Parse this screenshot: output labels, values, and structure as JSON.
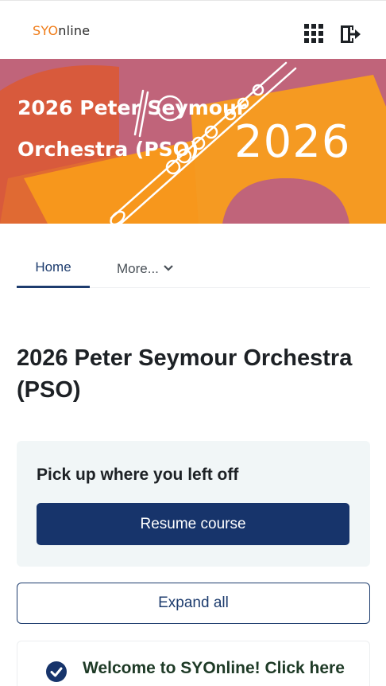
{
  "header": {
    "logo_part1": "SYO",
    "logo_part2": "nline",
    "apps_icon": "grid-apps-icon",
    "logout_icon": "logout-icon"
  },
  "banner": {
    "title": "2026 Peter Seymour Orchestra (PSO)",
    "year": "2026",
    "colors": {
      "pink": "#c0647a",
      "orange": "#f7971c",
      "red": "#d85a3c"
    }
  },
  "nav": {
    "tabs": [
      {
        "label": "Home",
        "active": true
      },
      {
        "label": "More...",
        "active": false
      }
    ]
  },
  "main": {
    "title": "2026 Peter Seymour Orchestra (PSO)",
    "resume": {
      "heading": "Pick up where you left off",
      "button": "Resume course"
    },
    "expand_all": "Expand all",
    "section": {
      "title": "Welcome to SYOnline! Click here",
      "status_icon": "check-circle-icon"
    }
  },
  "colors": {
    "primary": "#17346b",
    "card_bg": "#f1f6f7",
    "logo_orange": "#f07d1a"
  }
}
